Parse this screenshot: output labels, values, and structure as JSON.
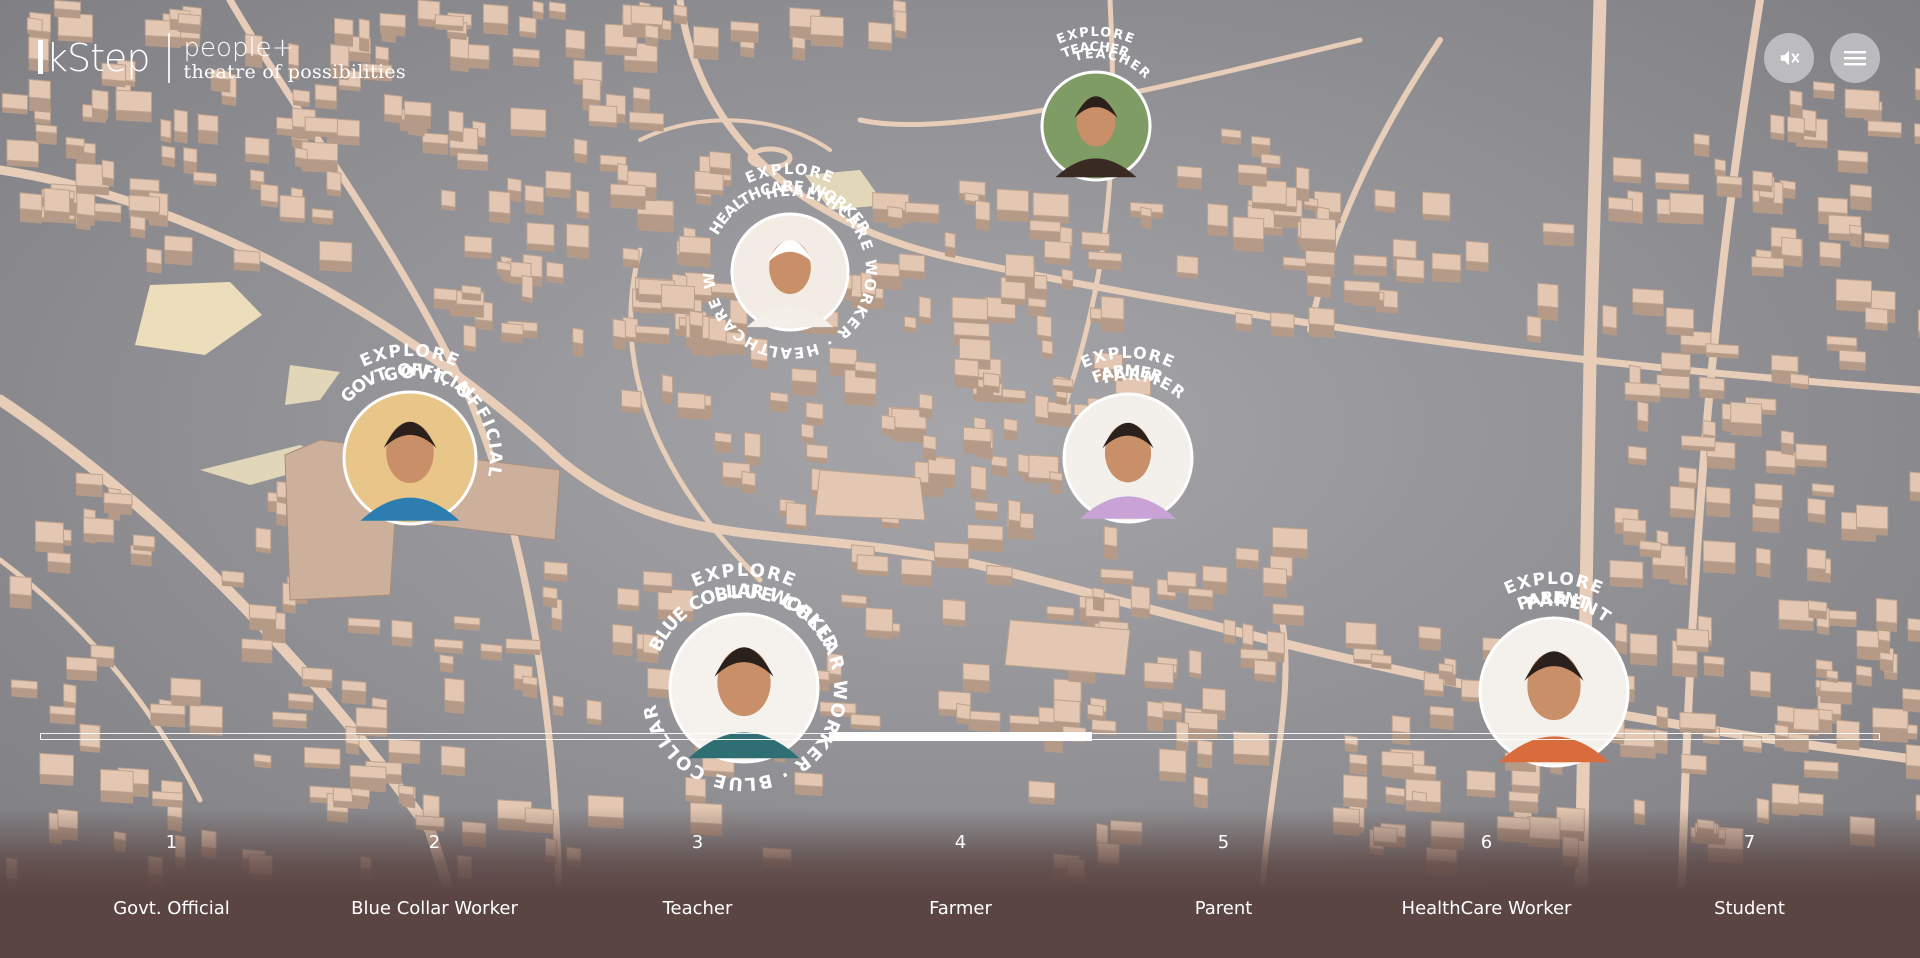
{
  "header": {
    "brand": "kStep",
    "product": "people+",
    "tagline": "theatre of possibilities"
  },
  "controls": {
    "mute_icon": "speaker-muted-icon",
    "menu_icon": "hamburger-menu-icon"
  },
  "personas": [
    {
      "id": "teacher",
      "explore": "EXPLORE",
      "role": "TEACHER",
      "ring": "TEACHER",
      "avatar_bg": "#7f9c64"
    },
    {
      "id": "healthcare",
      "explore": "EXPLORE",
      "role": "HEALTHCARE WORKER",
      "ring": "HEALTHCARE WORKER · HEALTHCARE WORKER",
      "avatar_bg": "#f2ece4"
    },
    {
      "id": "govt",
      "explore": "EXPLORE",
      "role": "GOVT. OFFICIAL",
      "ring": "GOVT. OFFICIAL",
      "avatar_bg": "#e8c68a"
    },
    {
      "id": "farmer",
      "explore": "EXPLORE",
      "role": "FARMER",
      "ring": "FARMER",
      "avatar_bg": "#f3f0ec"
    },
    {
      "id": "bluecollar",
      "explore": "EXPLORE",
      "role": "BLUE COLLAR WORKER",
      "ring": "BLUE COLLAR WORKER · BLUE COLLAR WORKER",
      "avatar_bg": "#f5f2ee"
    },
    {
      "id": "parent",
      "explore": "EXPLORE",
      "role": "PARENT",
      "ring": "PARENT",
      "avatar_bg": "#f4f1ec"
    }
  ],
  "timeline": {
    "active_index": 4,
    "items": [
      {
        "num": "1",
        "label": "Govt. Official"
      },
      {
        "num": "2",
        "label": "Blue Collar Worker"
      },
      {
        "num": "3",
        "label": "Teacher"
      },
      {
        "num": "4",
        "label": "Farmer"
      },
      {
        "num": "5",
        "label": "Parent"
      },
      {
        "num": "6",
        "label": "HealthCare Worker"
      },
      {
        "num": "7",
        "label": "Student"
      }
    ]
  },
  "colors": {
    "ground": "#8f8f92",
    "road": "#e8cdb8",
    "building": "#e3c7b2",
    "water": "#f6e7c0",
    "timeline_bg": "#5b4543"
  }
}
